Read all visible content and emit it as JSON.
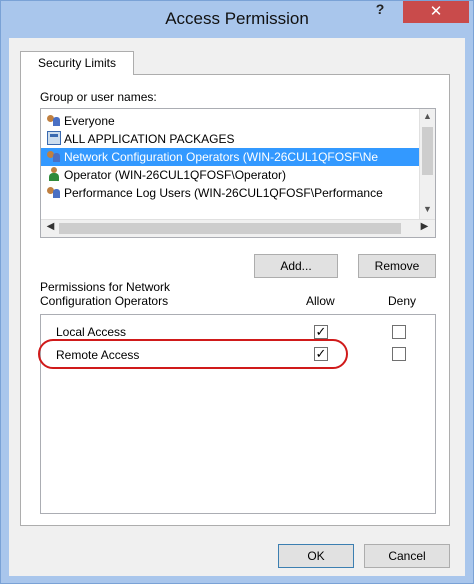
{
  "window": {
    "title": "Access Permission",
    "help_glyph": "?",
    "close_glyph": "✕"
  },
  "tabs": [
    {
      "label": "Security Limits"
    }
  ],
  "group_section": {
    "label": "Group or user names:",
    "items": [
      {
        "name": "Everyone",
        "icon": "group-icon",
        "selected": false
      },
      {
        "name": "ALL APPLICATION PACKAGES",
        "icon": "app-packages-icon",
        "selected": false
      },
      {
        "name": "Network Configuration Operators (WIN-26CUL1QFOSF\\Ne",
        "icon": "group-icon",
        "selected": true
      },
      {
        "name": "Operator (WIN-26CUL1QFOSF\\Operator)",
        "icon": "user-icon",
        "selected": false
      },
      {
        "name": "Performance Log Users (WIN-26CUL1QFOSF\\Performance",
        "icon": "group-icon",
        "selected": false
      }
    ],
    "add_label": "Add...",
    "remove_label": "Remove"
  },
  "permissions": {
    "label_line1": "Permissions for Network",
    "label_line2": "Configuration Operators",
    "allow_header": "Allow",
    "deny_header": "Deny",
    "rows": [
      {
        "name": "Local Access",
        "allow": true,
        "deny": false
      },
      {
        "name": "Remote Access",
        "allow": true,
        "deny": false
      }
    ],
    "highlighted_row": "Remote Access"
  },
  "footer": {
    "ok_label": "OK",
    "cancel_label": "Cancel"
  },
  "colors": {
    "titlebar": "#a9c6ec",
    "close_button": "#c94b4b",
    "selection": "#3399ff",
    "annotation": "#d01a1a"
  }
}
